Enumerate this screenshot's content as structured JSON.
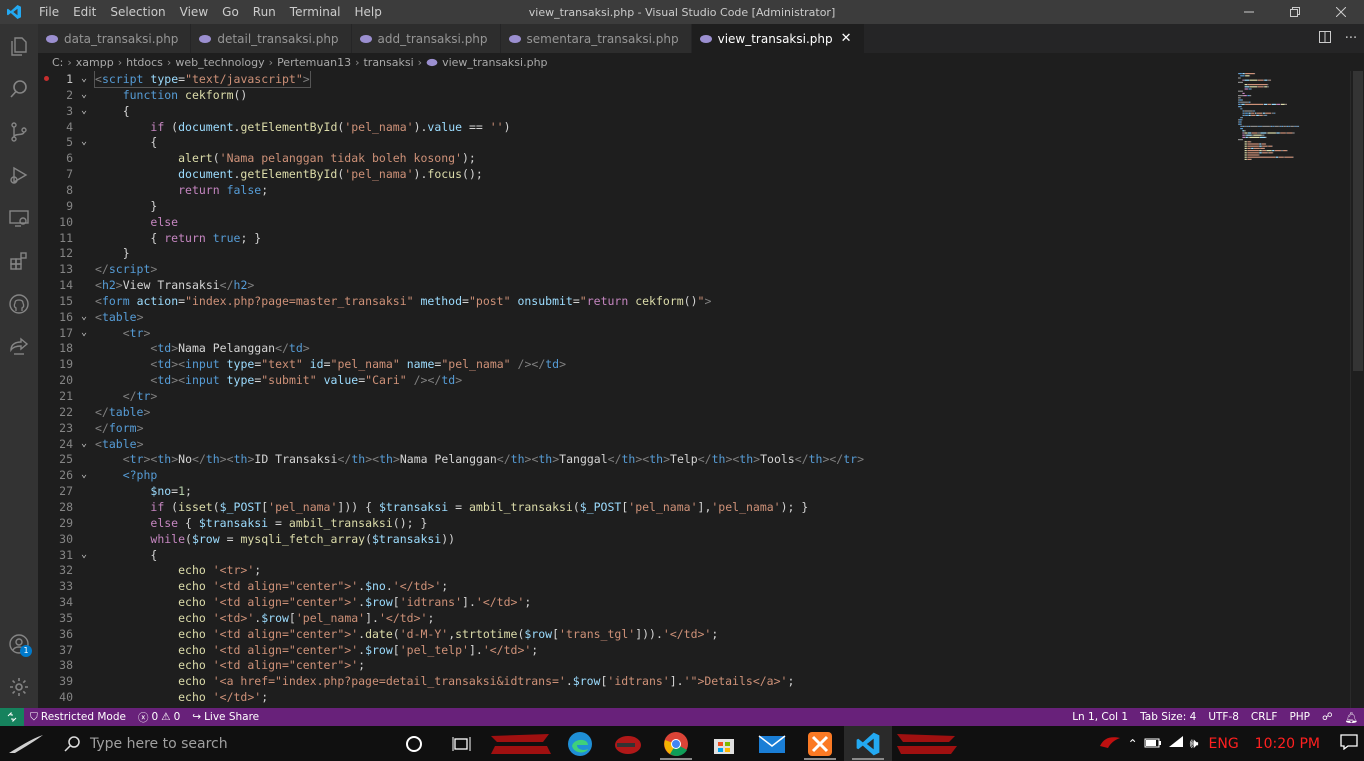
{
  "window": {
    "title": "view_transaksi.php - Visual Studio Code [Administrator]",
    "menu": [
      "File",
      "Edit",
      "Selection",
      "View",
      "Go",
      "Run",
      "Terminal",
      "Help"
    ]
  },
  "tabs": [
    {
      "label": "data_transaksi.php",
      "active": false
    },
    {
      "label": "detail_transaksi.php",
      "active": false
    },
    {
      "label": "add_transaksi.php",
      "active": false
    },
    {
      "label": "sementara_transaksi.php",
      "active": false
    },
    {
      "label": "view_transaksi.php",
      "active": true
    }
  ],
  "breadcrumb": [
    "C:",
    "xampp",
    "htdocs",
    "web_technology",
    "Pertemuan13",
    "transaksi",
    "view_transaksi.php"
  ],
  "code_lines": [
    [
      [
        "t-punc",
        "<"
      ],
      [
        "t-tag",
        "script"
      ],
      [
        "t-txt",
        " "
      ],
      [
        "t-attr",
        "type"
      ],
      [
        "t-txt",
        "="
      ],
      [
        "t-str",
        "\"text/javascript\""
      ],
      [
        "t-punc",
        ">"
      ]
    ],
    [
      [
        "t-txt",
        "    "
      ],
      [
        "t-kw",
        "function"
      ],
      [
        "t-txt",
        " "
      ],
      [
        "t-fn",
        "cekform"
      ],
      [
        "t-txt",
        "()"
      ]
    ],
    [
      [
        "t-txt",
        "    {"
      ]
    ],
    [
      [
        "t-txt",
        "        "
      ],
      [
        "t-ctl",
        "if"
      ],
      [
        "t-txt",
        " ("
      ],
      [
        "t-var",
        "document"
      ],
      [
        "t-txt",
        "."
      ],
      [
        "t-fn",
        "getElementById"
      ],
      [
        "t-txt",
        "("
      ],
      [
        "t-str",
        "'pel_nama'"
      ],
      [
        "t-txt",
        ")."
      ],
      [
        "t-var",
        "value"
      ],
      [
        "t-txt",
        " == "
      ],
      [
        "t-str",
        "''"
      ],
      [
        "t-txt",
        ")"
      ]
    ],
    [
      [
        "t-txt",
        "        {"
      ]
    ],
    [
      [
        "t-txt",
        "            "
      ],
      [
        "t-fn",
        "alert"
      ],
      [
        "t-txt",
        "("
      ],
      [
        "t-str",
        "'Nama pelanggan tidak boleh kosong'"
      ],
      [
        "t-txt",
        ");"
      ]
    ],
    [
      [
        "t-txt",
        "            "
      ],
      [
        "t-var",
        "document"
      ],
      [
        "t-txt",
        "."
      ],
      [
        "t-fn",
        "getElementById"
      ],
      [
        "t-txt",
        "("
      ],
      [
        "t-str",
        "'pel_nama'"
      ],
      [
        "t-txt",
        ")."
      ],
      [
        "t-fn",
        "focus"
      ],
      [
        "t-txt",
        "();"
      ]
    ],
    [
      [
        "t-txt",
        "            "
      ],
      [
        "t-ctl",
        "return"
      ],
      [
        "t-txt",
        " "
      ],
      [
        "t-kw",
        "false"
      ],
      [
        "t-txt",
        ";"
      ]
    ],
    [
      [
        "t-txt",
        "        }"
      ]
    ],
    [
      [
        "t-txt",
        "        "
      ],
      [
        "t-ctl",
        "else"
      ]
    ],
    [
      [
        "t-txt",
        "        { "
      ],
      [
        "t-ctl",
        "return"
      ],
      [
        "t-txt",
        " "
      ],
      [
        "t-kw",
        "true"
      ],
      [
        "t-txt",
        "; }"
      ]
    ],
    [
      [
        "t-txt",
        "    }"
      ]
    ],
    [
      [
        "t-punc",
        "</"
      ],
      [
        "t-tag",
        "script"
      ],
      [
        "t-punc",
        ">"
      ]
    ],
    [
      [
        "t-punc",
        "<"
      ],
      [
        "t-tag",
        "h2"
      ],
      [
        "t-punc",
        ">"
      ],
      [
        "t-txt",
        "View Transaksi"
      ],
      [
        "t-punc",
        "</"
      ],
      [
        "t-tag",
        "h2"
      ],
      [
        "t-punc",
        ">"
      ]
    ],
    [
      [
        "t-punc",
        "<"
      ],
      [
        "t-tag",
        "form"
      ],
      [
        "t-txt",
        " "
      ],
      [
        "t-attr",
        "action"
      ],
      [
        "t-txt",
        "="
      ],
      [
        "t-str",
        "\"index.php?page=master_transaksi\""
      ],
      [
        "t-txt",
        " "
      ],
      [
        "t-attr",
        "method"
      ],
      [
        "t-txt",
        "="
      ],
      [
        "t-str",
        "\"post\""
      ],
      [
        "t-txt",
        " "
      ],
      [
        "t-attr",
        "onsubmit"
      ],
      [
        "t-txt",
        "="
      ],
      [
        "t-str",
        "\""
      ],
      [
        "t-ctl",
        "return"
      ],
      [
        "t-txt",
        " "
      ],
      [
        "t-fn",
        "cekform"
      ],
      [
        "t-txt",
        "()"
      ],
      [
        "t-str",
        "\""
      ],
      [
        "t-punc",
        ">"
      ]
    ],
    [
      [
        "t-punc",
        "<"
      ],
      [
        "t-tag",
        "table"
      ],
      [
        "t-punc",
        ">"
      ]
    ],
    [
      [
        "t-txt",
        "    "
      ],
      [
        "t-punc",
        "<"
      ],
      [
        "t-tag",
        "tr"
      ],
      [
        "t-punc",
        ">"
      ]
    ],
    [
      [
        "t-txt",
        "        "
      ],
      [
        "t-punc",
        "<"
      ],
      [
        "t-tag",
        "td"
      ],
      [
        "t-punc",
        ">"
      ],
      [
        "t-txt",
        "Nama Pelanggan"
      ],
      [
        "t-punc",
        "</"
      ],
      [
        "t-tag",
        "td"
      ],
      [
        "t-punc",
        ">"
      ]
    ],
    [
      [
        "t-txt",
        "        "
      ],
      [
        "t-punc",
        "<"
      ],
      [
        "t-tag",
        "td"
      ],
      [
        "t-punc",
        "><"
      ],
      [
        "t-tag",
        "input"
      ],
      [
        "t-txt",
        " "
      ],
      [
        "t-attr",
        "type"
      ],
      [
        "t-txt",
        "="
      ],
      [
        "t-str",
        "\"text\""
      ],
      [
        "t-txt",
        " "
      ],
      [
        "t-attr",
        "id"
      ],
      [
        "t-txt",
        "="
      ],
      [
        "t-str",
        "\"pel_nama\""
      ],
      [
        "t-txt",
        " "
      ],
      [
        "t-attr",
        "name"
      ],
      [
        "t-txt",
        "="
      ],
      [
        "t-str",
        "\"pel_nama\""
      ],
      [
        "t-txt",
        " "
      ],
      [
        "t-punc",
        "/></"
      ],
      [
        "t-tag",
        "td"
      ],
      [
        "t-punc",
        ">"
      ]
    ],
    [
      [
        "t-txt",
        "        "
      ],
      [
        "t-punc",
        "<"
      ],
      [
        "t-tag",
        "td"
      ],
      [
        "t-punc",
        "><"
      ],
      [
        "t-tag",
        "input"
      ],
      [
        "t-txt",
        " "
      ],
      [
        "t-attr",
        "type"
      ],
      [
        "t-txt",
        "="
      ],
      [
        "t-str",
        "\"submit\""
      ],
      [
        "t-txt",
        " "
      ],
      [
        "t-attr",
        "value"
      ],
      [
        "t-txt",
        "="
      ],
      [
        "t-str",
        "\"Cari\""
      ],
      [
        "t-txt",
        " "
      ],
      [
        "t-punc",
        "/></"
      ],
      [
        "t-tag",
        "td"
      ],
      [
        "t-punc",
        ">"
      ]
    ],
    [
      [
        "t-txt",
        "    "
      ],
      [
        "t-punc",
        "</"
      ],
      [
        "t-tag",
        "tr"
      ],
      [
        "t-punc",
        ">"
      ]
    ],
    [
      [
        "t-punc",
        "</"
      ],
      [
        "t-tag",
        "table"
      ],
      [
        "t-punc",
        ">"
      ]
    ],
    [
      [
        "t-punc",
        "</"
      ],
      [
        "t-tag",
        "form"
      ],
      [
        "t-punc",
        ">"
      ]
    ],
    [
      [
        "t-punc",
        "<"
      ],
      [
        "t-tag",
        "table"
      ],
      [
        "t-punc",
        ">"
      ]
    ],
    [
      [
        "t-txt",
        "    "
      ],
      [
        "t-punc",
        "<"
      ],
      [
        "t-tag",
        "tr"
      ],
      [
        "t-punc",
        "><"
      ],
      [
        "t-tag",
        "th"
      ],
      [
        "t-punc",
        ">"
      ],
      [
        "t-txt",
        "No"
      ],
      [
        "t-punc",
        "</"
      ],
      [
        "t-tag",
        "th"
      ],
      [
        "t-punc",
        "><"
      ],
      [
        "t-tag",
        "th"
      ],
      [
        "t-punc",
        ">"
      ],
      [
        "t-txt",
        "ID Transaksi"
      ],
      [
        "t-punc",
        "</"
      ],
      [
        "t-tag",
        "th"
      ],
      [
        "t-punc",
        "><"
      ],
      [
        "t-tag",
        "th"
      ],
      [
        "t-punc",
        ">"
      ],
      [
        "t-txt",
        "Nama Pelanggan"
      ],
      [
        "t-punc",
        "</"
      ],
      [
        "t-tag",
        "th"
      ],
      [
        "t-punc",
        "><"
      ],
      [
        "t-tag",
        "th"
      ],
      [
        "t-punc",
        ">"
      ],
      [
        "t-txt",
        "Tanggal"
      ],
      [
        "t-punc",
        "</"
      ],
      [
        "t-tag",
        "th"
      ],
      [
        "t-punc",
        "><"
      ],
      [
        "t-tag",
        "th"
      ],
      [
        "t-punc",
        ">"
      ],
      [
        "t-txt",
        "Telp"
      ],
      [
        "t-punc",
        "</"
      ],
      [
        "t-tag",
        "th"
      ],
      [
        "t-punc",
        "><"
      ],
      [
        "t-tag",
        "th"
      ],
      [
        "t-punc",
        ">"
      ],
      [
        "t-txt",
        "Tools"
      ],
      [
        "t-punc",
        "</"
      ],
      [
        "t-tag",
        "th"
      ],
      [
        "t-punc",
        "></"
      ],
      [
        "t-tag",
        "tr"
      ],
      [
        "t-punc",
        ">"
      ]
    ],
    [
      [
        "t-txt",
        "    "
      ],
      [
        "t-tag",
        "<?php"
      ]
    ],
    [
      [
        "t-txt",
        "        "
      ],
      [
        "t-var",
        "$no"
      ],
      [
        "t-txt",
        "="
      ],
      [
        "t-num",
        "1"
      ],
      [
        "t-txt",
        ";"
      ]
    ],
    [
      [
        "t-txt",
        "        "
      ],
      [
        "t-ctl",
        "if"
      ],
      [
        "t-txt",
        " ("
      ],
      [
        "t-fn",
        "isset"
      ],
      [
        "t-txt",
        "("
      ],
      [
        "t-var",
        "$_POST"
      ],
      [
        "t-txt",
        "["
      ],
      [
        "t-str",
        "'pel_nama'"
      ],
      [
        "t-txt",
        "])) { "
      ],
      [
        "t-var",
        "$transaksi"
      ],
      [
        "t-txt",
        " = "
      ],
      [
        "t-fn",
        "ambil_transaksi"
      ],
      [
        "t-txt",
        "("
      ],
      [
        "t-var",
        "$_POST"
      ],
      [
        "t-txt",
        "["
      ],
      [
        "t-str",
        "'pel_nama'"
      ],
      [
        "t-txt",
        "],"
      ],
      [
        "t-str",
        "'pel_nama'"
      ],
      [
        "t-txt",
        "); }"
      ]
    ],
    [
      [
        "t-txt",
        "        "
      ],
      [
        "t-ctl",
        "else"
      ],
      [
        "t-txt",
        " { "
      ],
      [
        "t-var",
        "$transaksi"
      ],
      [
        "t-txt",
        " = "
      ],
      [
        "t-fn",
        "ambil_transaksi"
      ],
      [
        "t-txt",
        "(); }"
      ]
    ],
    [
      [
        "t-txt",
        "        "
      ],
      [
        "t-ctl",
        "while"
      ],
      [
        "t-txt",
        "("
      ],
      [
        "t-var",
        "$row"
      ],
      [
        "t-txt",
        " = "
      ],
      [
        "t-fn",
        "mysqli_fetch_array"
      ],
      [
        "t-txt",
        "("
      ],
      [
        "t-var",
        "$transaksi"
      ],
      [
        "t-txt",
        "))"
      ]
    ],
    [
      [
        "t-txt",
        "        {"
      ]
    ],
    [
      [
        "t-txt",
        "            "
      ],
      [
        "t-fn",
        "echo"
      ],
      [
        "t-txt",
        " "
      ],
      [
        "t-str",
        "'<tr>'"
      ],
      [
        "t-txt",
        ";"
      ]
    ],
    [
      [
        "t-txt",
        "            "
      ],
      [
        "t-fn",
        "echo"
      ],
      [
        "t-txt",
        " "
      ],
      [
        "t-str",
        "'<td align=\"center\">'"
      ],
      [
        "t-txt",
        "."
      ],
      [
        "t-var",
        "$no"
      ],
      [
        "t-txt",
        "."
      ],
      [
        "t-str",
        "'</td>'"
      ],
      [
        "t-txt",
        ";"
      ]
    ],
    [
      [
        "t-txt",
        "            "
      ],
      [
        "t-fn",
        "echo"
      ],
      [
        "t-txt",
        " "
      ],
      [
        "t-str",
        "'<td align=\"center\">'"
      ],
      [
        "t-txt",
        "."
      ],
      [
        "t-var",
        "$row"
      ],
      [
        "t-txt",
        "["
      ],
      [
        "t-str",
        "'idtrans'"
      ],
      [
        "t-txt",
        "]."
      ],
      [
        "t-str",
        "'</td>'"
      ],
      [
        "t-txt",
        ";"
      ]
    ],
    [
      [
        "t-txt",
        "            "
      ],
      [
        "t-fn",
        "echo"
      ],
      [
        "t-txt",
        " "
      ],
      [
        "t-str",
        "'<td>'"
      ],
      [
        "t-txt",
        "."
      ],
      [
        "t-var",
        "$row"
      ],
      [
        "t-txt",
        "["
      ],
      [
        "t-str",
        "'pel_nama'"
      ],
      [
        "t-txt",
        "]."
      ],
      [
        "t-str",
        "'</td>'"
      ],
      [
        "t-txt",
        ";"
      ]
    ],
    [
      [
        "t-txt",
        "            "
      ],
      [
        "t-fn",
        "echo"
      ],
      [
        "t-txt",
        " "
      ],
      [
        "t-str",
        "'<td align=\"center\">'"
      ],
      [
        "t-txt",
        "."
      ],
      [
        "t-fn",
        "date"
      ],
      [
        "t-txt",
        "("
      ],
      [
        "t-str",
        "'d-M-Y'"
      ],
      [
        "t-txt",
        ","
      ],
      [
        "t-fn",
        "strtotime"
      ],
      [
        "t-txt",
        "("
      ],
      [
        "t-var",
        "$row"
      ],
      [
        "t-txt",
        "["
      ],
      [
        "t-str",
        "'trans_tgl'"
      ],
      [
        "t-txt",
        "]))."
      ],
      [
        "t-str",
        "'</td>'"
      ],
      [
        "t-txt",
        ";"
      ]
    ],
    [
      [
        "t-txt",
        "            "
      ],
      [
        "t-fn",
        "echo"
      ],
      [
        "t-txt",
        " "
      ],
      [
        "t-str",
        "'<td align=\"center\">'"
      ],
      [
        "t-txt",
        "."
      ],
      [
        "t-var",
        "$row"
      ],
      [
        "t-txt",
        "["
      ],
      [
        "t-str",
        "'pel_telp'"
      ],
      [
        "t-txt",
        "]."
      ],
      [
        "t-str",
        "'</td>'"
      ],
      [
        "t-txt",
        ";"
      ]
    ],
    [
      [
        "t-txt",
        "            "
      ],
      [
        "t-fn",
        "echo"
      ],
      [
        "t-txt",
        " "
      ],
      [
        "t-str",
        "'<td align=\"center\">'"
      ],
      [
        "t-txt",
        ";"
      ]
    ],
    [
      [
        "t-txt",
        "            "
      ],
      [
        "t-fn",
        "echo"
      ],
      [
        "t-txt",
        " "
      ],
      [
        "t-str",
        "'<a href=\"index.php?page=detail_transaksi&idtrans='"
      ],
      [
        "t-txt",
        "."
      ],
      [
        "t-var",
        "$row"
      ],
      [
        "t-txt",
        "["
      ],
      [
        "t-str",
        "'idtrans'"
      ],
      [
        "t-txt",
        "]."
      ],
      [
        "t-str",
        "'\">Details</a>'"
      ],
      [
        "t-txt",
        ";"
      ]
    ],
    [
      [
        "t-txt",
        "            "
      ],
      [
        "t-fn",
        "echo"
      ],
      [
        "t-txt",
        " "
      ],
      [
        "t-str",
        "'</td>'"
      ],
      [
        "t-txt",
        ";"
      ]
    ]
  ],
  "fold_lines": [
    1,
    2,
    3,
    5,
    16,
    17,
    24,
    26,
    31
  ],
  "current_line": 1,
  "statusbar": {
    "mode": "Restricted Mode",
    "errors": "0",
    "warnings": "0",
    "live_share": "Live Share",
    "position": "Ln 1, Col 1",
    "tab_size": "Tab Size: 4",
    "encoding": "UTF-8",
    "eol": "CRLF",
    "language": "PHP"
  },
  "taskbar": {
    "search_placeholder": "Type here to search",
    "language": "ENG",
    "time": "10:20 PM"
  },
  "colors": {
    "statusbar": "#68217a",
    "remote": "#16825d",
    "tray_text": "#ff2020"
  }
}
